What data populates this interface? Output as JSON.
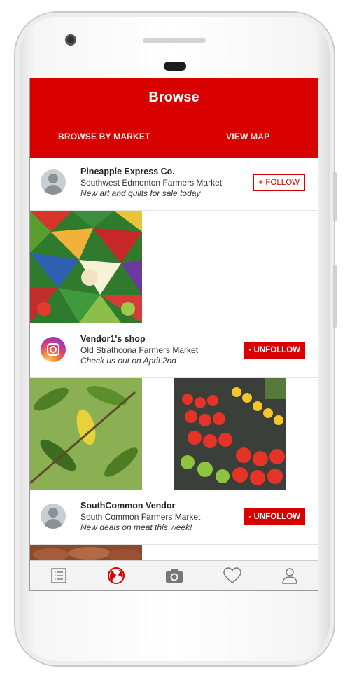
{
  "header": {
    "title": "Browse"
  },
  "tabs": [
    {
      "label": "BROWSE BY MARKET"
    },
    {
      "label": "VIEW MAP"
    }
  ],
  "feed": [
    {
      "name": "Pineapple Express Co.",
      "market": "Southwest Edmonton Farmers Market",
      "message": "New art and quilts for sale today",
      "button": "+ FOLLOW",
      "avatar_icon": "default-avatar-icon"
    },
    {
      "name": "Vendor1's shop",
      "market": "Old Strathcona Farmers Market",
      "message": "Check us out on April 2nd",
      "button": "- UNFOLLOW",
      "avatar_icon": "instagram-icon"
    },
    {
      "name": "SouthCommon Vendor",
      "market": "South Common Farmers Market",
      "message": "New deals on meat this week!",
      "button": "- UNFOLLOW",
      "avatar_icon": "default-avatar-icon"
    }
  ],
  "photos": [
    "quilt-photo",
    "leaves-photo",
    "vegetables-photo",
    "meat-photo"
  ],
  "nav": [
    "list-icon",
    "globe-icon",
    "camera-icon",
    "heart-icon",
    "profile-icon"
  ],
  "colors": {
    "accent": "#d90000",
    "active_nav": "#d90000",
    "inactive_nav": "#777777"
  }
}
